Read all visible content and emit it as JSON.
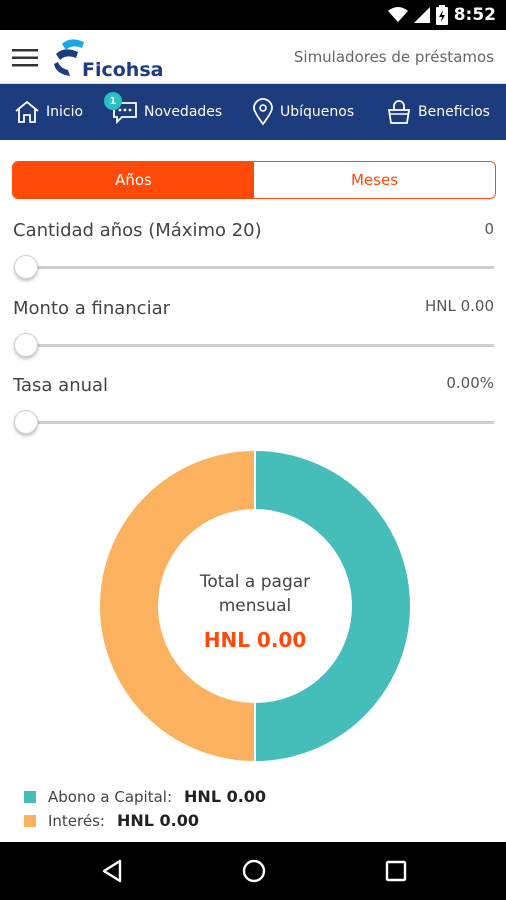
{
  "status": {
    "time": "8:52"
  },
  "appbar": {
    "brand": "Ficohsa",
    "title": "Simuladores de préstamos"
  },
  "nav": {
    "items": [
      {
        "label": "Inicio",
        "icon": "home-icon"
      },
      {
        "label": "Novedades",
        "icon": "chat-icon",
        "badge": "1"
      },
      {
        "label": "Ubíquenos",
        "icon": "location-pin-icon"
      },
      {
        "label": "Beneficios",
        "icon": "shopping-bag-icon"
      }
    ]
  },
  "toggle": {
    "years": "Años",
    "months": "Meses",
    "selected": "years"
  },
  "fields": {
    "years": {
      "label": "Cantidad años (Máximo 20)",
      "value": "0",
      "level": 0
    },
    "amount": {
      "label": "Monto a financiar",
      "value": "HNL 0.00",
      "level": 0
    },
    "rate": {
      "label": "Tasa anual",
      "value": "0.00%",
      "level": 0
    }
  },
  "summary": {
    "total_label_1": "Total a pagar",
    "total_label_2": "mensual",
    "total_value": "HNL 0.00"
  },
  "chart_data": {
    "type": "pie",
    "categories": [
      "Abono a Capital",
      "Interés"
    ],
    "values": [
      50,
      50
    ],
    "colors": [
      "#45bdb9",
      "#fbb15e"
    ]
  },
  "legend": {
    "capital_label": "Abono a Capital:",
    "capital_value": "HNL 0.00",
    "interest_label": "Interés:",
    "interest_value": "HNL 0.00"
  },
  "colors": {
    "brand_blue": "#1d3c7d",
    "accent_orange": "#ff4a0a",
    "teal": "#45bdb9",
    "amber": "#fbb15e"
  }
}
